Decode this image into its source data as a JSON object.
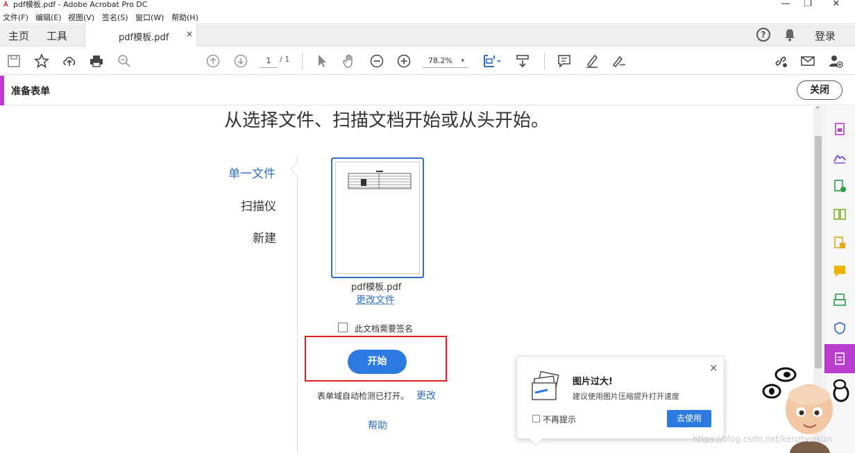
{
  "window": {
    "title": "pdf模板.pdf - Adobe Acrobat Pro DC",
    "minimize": "—",
    "restore": "❐",
    "close": "✕"
  },
  "menu": [
    "文件(F)",
    "编辑(E)",
    "视图(V)",
    "签名(S)",
    "窗口(W)",
    "帮助(H)"
  ],
  "tabs": {
    "home": "主页",
    "tools": "工具",
    "document": "pdf模板.pdf",
    "close_glyph": "×",
    "help_glyph": "?",
    "login": "登录"
  },
  "toolbar": {
    "page_current": "1",
    "page_total": "/ 1",
    "zoom": "78.2%",
    "zoom_caret": "▾"
  },
  "tool_header": {
    "name": "准备表单",
    "close_label": "关闭"
  },
  "main": {
    "heading": "从选择文件、扫描文档开始或从头开始。",
    "options": [
      "单一文件",
      "扫描仪",
      "新建"
    ],
    "file_name": "pdf模板.pdf",
    "change_file": "更改文件",
    "sign_label": "此文档需要签名",
    "start_label": "开始",
    "detect_text": "表单域自动检测已打开。",
    "detect_change": "更改",
    "help_label": "帮助"
  },
  "popup": {
    "title": "图片过大!",
    "body": "建议使用图片压缩提升打开速度",
    "dont_show": "不再提示",
    "go_label": "去使用",
    "close_glyph": "×"
  },
  "watermark": "https://blog.csdn.net/kenzhenkun",
  "colors": {
    "accent_purple": "#b93ed0",
    "primary_blue": "#2c7ae0",
    "link_blue": "#2d6fc4",
    "highlight_red": "#e51c1c"
  }
}
